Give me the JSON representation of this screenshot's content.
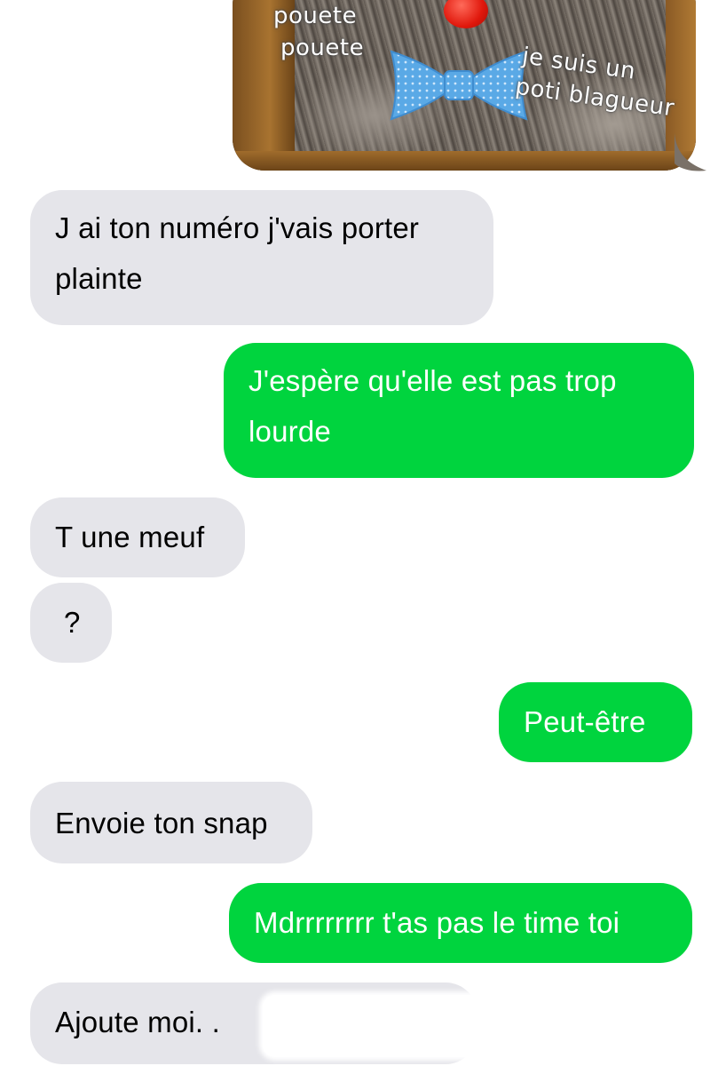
{
  "image_message": {
    "captions": [
      "pouete",
      "pouete",
      "je suis un",
      "poti blagueur"
    ],
    "accent_nose": "#e0180c",
    "accent_bowtie": "#5aa9e6"
  },
  "messages": [
    {
      "direction": "incoming",
      "text": "J ai ton numéro j'vais porter plainte",
      "lines": [
        "J ai ton numéro j'vais porter",
        "plainte"
      ]
    },
    {
      "direction": "outgoing",
      "text": "J'espère qu'elle est pas trop lourde",
      "lines": [
        "J'espère qu'elle est pas trop",
        "lourde"
      ]
    },
    {
      "direction": "incoming",
      "text": "T une meuf"
    },
    {
      "direction": "incoming",
      "text": "?"
    },
    {
      "direction": "outgoing",
      "text": "Peut-être"
    },
    {
      "direction": "incoming",
      "text": "Envoie ton snap"
    },
    {
      "direction": "outgoing",
      "text": "Mdrrrrrrrr t'as pas le time toi"
    },
    {
      "direction": "incoming",
      "text": "Ajoute moi. ."
    }
  ],
  "colors": {
    "incoming_bubble": "#e5e5ea",
    "outgoing_bubble": "#00d43e",
    "incoming_text": "#000000",
    "outgoing_text": "#ffffff"
  }
}
